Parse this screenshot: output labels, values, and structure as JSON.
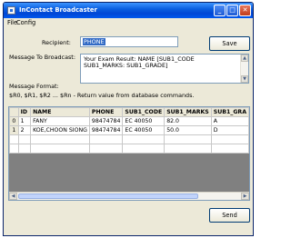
{
  "window": {
    "title": "InContact Broadcaster",
    "min": "_",
    "max": "□",
    "close": "✕"
  },
  "menu": {
    "file": "File",
    "config": "Config"
  },
  "form": {
    "recipient_label": "Recipient:",
    "recipient_value": "PHONE",
    "save_label": "Save",
    "message_label": "Message To Broadcast:",
    "message_value": "Your Exam Result: NAME [SUB1_CODE SUB1_MARKS: SUB1_GRADE]",
    "format_label": "Message Format:",
    "format_help": "$R0, $R1, $R2 ... $Rn - Return value from database commands.",
    "send_label": "Send"
  },
  "grid": {
    "columns": [
      "ID",
      "NAME",
      "PHONE",
      "SUB1_CODE",
      "SUB1_MARKS",
      "SUB1_GRA"
    ],
    "rows": [
      {
        "index": "0",
        "cells": [
          "1",
          "FANY",
          "98474784",
          "EC 40050",
          "82.0",
          "A"
        ]
      },
      {
        "index": "1",
        "cells": [
          "2",
          "KOE,CHOON SIONG",
          "98474784",
          "EC 40050",
          "50.0",
          "D"
        ]
      }
    ]
  },
  "icons": {
    "up": "▲",
    "down": "▼",
    "left": "◀",
    "right": "▶"
  }
}
